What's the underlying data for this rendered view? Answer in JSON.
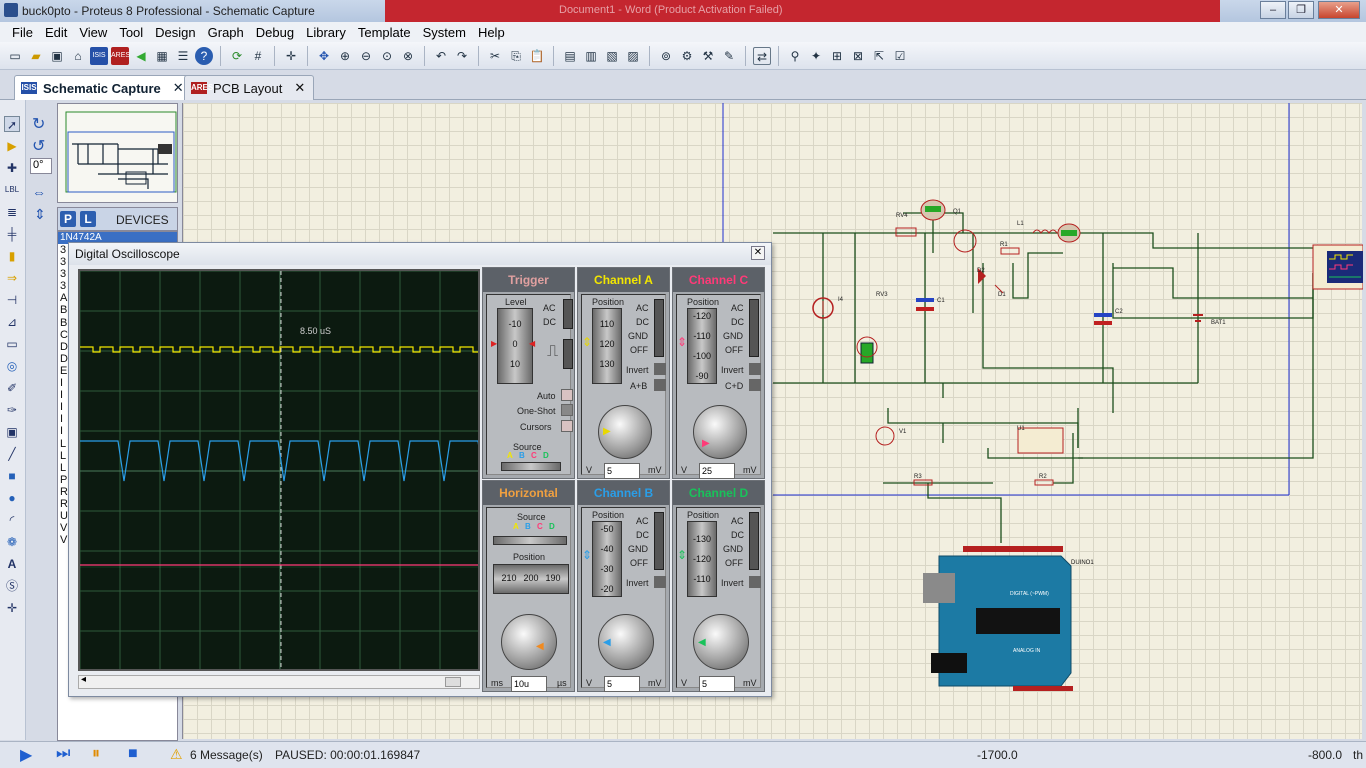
{
  "window": {
    "title": "buck0pto - Proteus 8 Professional - Schematic Capture",
    "background_title": "Document1 - Word (Product Activation Failed)"
  },
  "menu": [
    "File",
    "Edit",
    "View",
    "Tool",
    "Design",
    "Graph",
    "Debug",
    "Library",
    "Template",
    "System",
    "Help"
  ],
  "tabs": [
    {
      "label": "Schematic Capture",
      "icon": "ISIS"
    },
    {
      "label": "PCB Layout",
      "icon": "ARES"
    }
  ],
  "rotation": "0°",
  "devices": {
    "header": "DEVICES",
    "p_label": "P",
    "l_label": "L",
    "selected": "1N4742A",
    "letters": [
      "3",
      "3",
      "3",
      "3",
      "A",
      "B",
      "B",
      "C",
      "D",
      "D",
      "E",
      "I",
      "I",
      "I",
      "I",
      "I",
      "L",
      "L",
      "L",
      "P",
      "R",
      "R",
      "U",
      "V",
      "V"
    ]
  },
  "scope": {
    "title": "Digital Oscilloscope",
    "time_readout": "8.50 uS",
    "trigger": {
      "header": "Trigger",
      "level_label": "Level",
      "level_ticks": [
        "-10",
        "0",
        "10"
      ],
      "ac": "AC",
      "dc": "DC",
      "auto": "Auto",
      "one_shot": "One-Shot",
      "cursors": "Cursors",
      "source_label": "Source",
      "sources": [
        "A",
        "B",
        "C",
        "D"
      ]
    },
    "channel_a": {
      "header": "Channel A",
      "position_label": "Position",
      "ticks": [
        "110",
        "120",
        "130"
      ],
      "couplings": [
        "AC",
        "DC",
        "GND",
        "OFF"
      ],
      "invert": "Invert",
      "combine": "A+B",
      "value": "5",
      "unit": "mV",
      "v": "V",
      "color": "#f2e600"
    },
    "channel_c": {
      "header": "Channel C",
      "position_label": "Position",
      "ticks": [
        "-120",
        "-110",
        "-100",
        "-90"
      ],
      "couplings": [
        "AC",
        "DC",
        "GND",
        "OFF"
      ],
      "invert": "Invert",
      "combine": "C+D",
      "value": "25",
      "unit": "mV",
      "v": "V",
      "color": "#ff3a78"
    },
    "channel_b": {
      "header": "Channel B",
      "position_label": "Position",
      "ticks": [
        "-50",
        "-40",
        "-30",
        "-20"
      ],
      "couplings": [
        "AC",
        "DC",
        "GND",
        "OFF"
      ],
      "invert": "Invert",
      "value": "5",
      "unit": "mV",
      "v": "V",
      "color": "#2a9ee8"
    },
    "channel_d": {
      "header": "Channel D",
      "position_label": "Position",
      "ticks": [
        "-130",
        "-120",
        "-110"
      ],
      "couplings": [
        "AC",
        "DC",
        "GND",
        "OFF"
      ],
      "invert": "Invert",
      "value": "5",
      "unit": "mV",
      "v": "V",
      "color": "#19c25a"
    },
    "horizontal": {
      "header": "Horizontal",
      "source_label": "Source",
      "sources": [
        "A",
        "B",
        "C",
        "D"
      ],
      "position_label": "Position",
      "ticks": [
        "210",
        "200",
        "190"
      ],
      "value": "10u",
      "unit": "µs",
      "ms": "ms"
    },
    "dial_ticks": [
      "0.5",
      "0.2",
      "0.1",
      "50",
      "20",
      "10",
      "5",
      "2",
      "1",
      "200",
      "100",
      "50",
      "20",
      "10",
      "5",
      "2",
      "1",
      "20"
    ]
  },
  "status": {
    "messages": "6 Message(s)",
    "paused": "PAUSED: 00:00:01.169847",
    "x": "-1700.0",
    "y": "-800.0",
    "units": "th"
  },
  "schematic_labels": [
    "RV4",
    "Q1",
    "L1",
    "R1",
    "D2",
    "D1",
    "C1",
    "C2",
    "BAT1",
    "I4",
    "RV3",
    "V1",
    "U1",
    "R3",
    "R2",
    "DUINO1",
    "DIGITAL (~PWM)",
    "ANALOG IN"
  ]
}
